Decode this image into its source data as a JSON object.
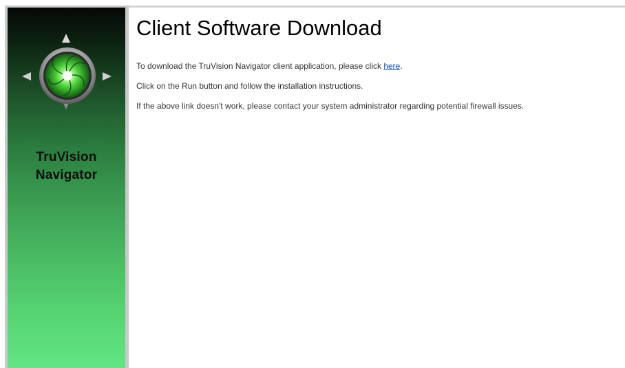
{
  "sidebar": {
    "brand_line1": "TruVision",
    "brand_line2": "Navigator"
  },
  "main": {
    "title": "Client Software Download",
    "line1_prefix": "To download the TruVision Navigator client application, please click ",
    "line1_link": "here",
    "line1_suffix": ".",
    "line2": "Click on the Run button and follow the installation instructions.",
    "line3": "If the above link doesn't work, please contact your system administrator regarding potential firewall issues."
  },
  "colors": {
    "link": "#0645c8",
    "sidebar_top": "#050806",
    "sidebar_bottom": "#62e584"
  }
}
